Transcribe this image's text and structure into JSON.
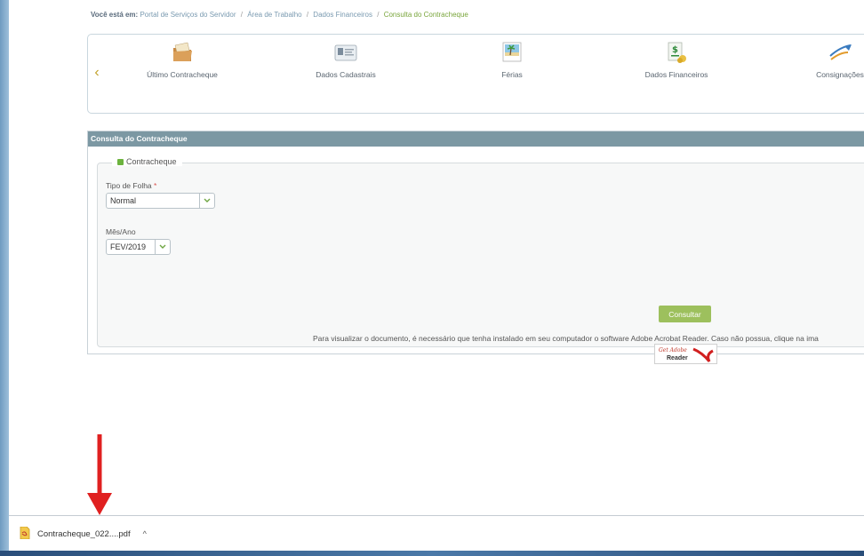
{
  "breadcrumb": {
    "lead": "Você está em:",
    "items": [
      "Portal de Serviços do Servidor",
      "Área de Trabalho",
      "Dados Financeiros"
    ],
    "current": "Consulta do Contracheque",
    "separator": "/"
  },
  "shortcuts": [
    {
      "label": "Último Contracheque",
      "icon": "folder-icon"
    },
    {
      "label": "Dados Cadastrais",
      "icon": "id-card-icon"
    },
    {
      "label": "Férias",
      "icon": "beach-picture-icon"
    },
    {
      "label": "Dados Financeiros",
      "icon": "money-icon"
    },
    {
      "label": "Consignações",
      "icon": "airplane-icon"
    }
  ],
  "carousel": {
    "prev_icon": "chevron-left-icon",
    "prev_glyph": "‹"
  },
  "panel": {
    "title": "Consulta do Contracheque",
    "legend": "Contracheque",
    "tipo_folha": {
      "label": "Tipo de Folha",
      "required_mark": "*",
      "value": "Normal"
    },
    "mes_ano": {
      "label": "Mês/Ano",
      "value": "FEV/2019"
    },
    "consultar_label": "Consultar",
    "notice": "Para visualizar o documento, é necessário que tenha instalado em seu computador o software Adobe Acrobat Reader. Caso não possua, clique na ima",
    "adobe": {
      "line1": "Get Adobe",
      "line2": "Reader"
    }
  },
  "download": {
    "filename": "Contracheque_022....pdf",
    "caret": "^"
  },
  "colors": {
    "panel_header": "#7c98a3",
    "consultar_button": "#9dc05d",
    "arrow": "#e02020",
    "current_crumb": "#79a53b"
  }
}
